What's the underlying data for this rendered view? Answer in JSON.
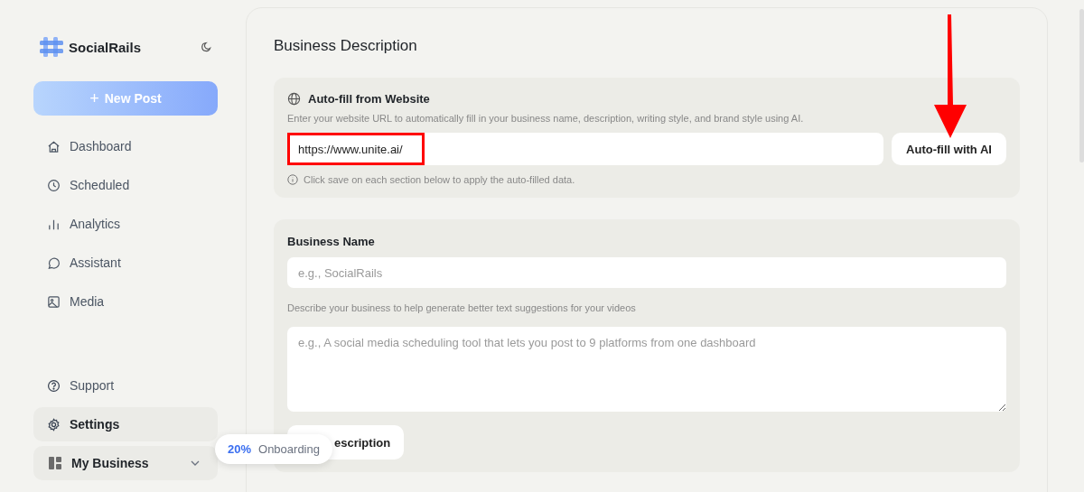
{
  "sidebar": {
    "brand": "SocialRails",
    "new_post": {
      "icon": "+",
      "label": "New Post"
    },
    "nav": [
      {
        "kind": "home",
        "label": "Dashboard",
        "selected": false
      },
      {
        "kind": "clock",
        "label": "Scheduled",
        "selected": false
      },
      {
        "kind": "chart",
        "label": "Analytics",
        "selected": false
      },
      {
        "kind": "chat",
        "label": "Assistant",
        "selected": false
      },
      {
        "kind": "image",
        "label": "Media",
        "selected": false
      }
    ],
    "bottom": [
      {
        "kind": "help",
        "label": "Support",
        "selected": false
      },
      {
        "kind": "gear",
        "label": "Settings",
        "selected": true
      }
    ],
    "workspace": {
      "label": "My Business",
      "expanded": false
    }
  },
  "main": {
    "title": "Business Description",
    "autofill": {
      "title": "Auto-fill from Website",
      "description": "Enter your website URL to automatically fill in your business name, description, writing style, and brand style using AI.",
      "url": "https://www.unite.ai/",
      "button": "Auto-fill with AI",
      "note": "Click save on each section below to apply the auto-filled data."
    },
    "business": {
      "name_label": "Business Name",
      "name_placeholder": "e.g., SocialRails",
      "description_hint": "Describe your business to help generate better text suggestions for your videos",
      "description_placeholder": "e.g., A social media scheduling tool that lets you post to 9 platforms from one dashboard",
      "save_button": "escription"
    }
  },
  "onboarding": {
    "percent": "20%",
    "label": "Onboarding"
  }
}
